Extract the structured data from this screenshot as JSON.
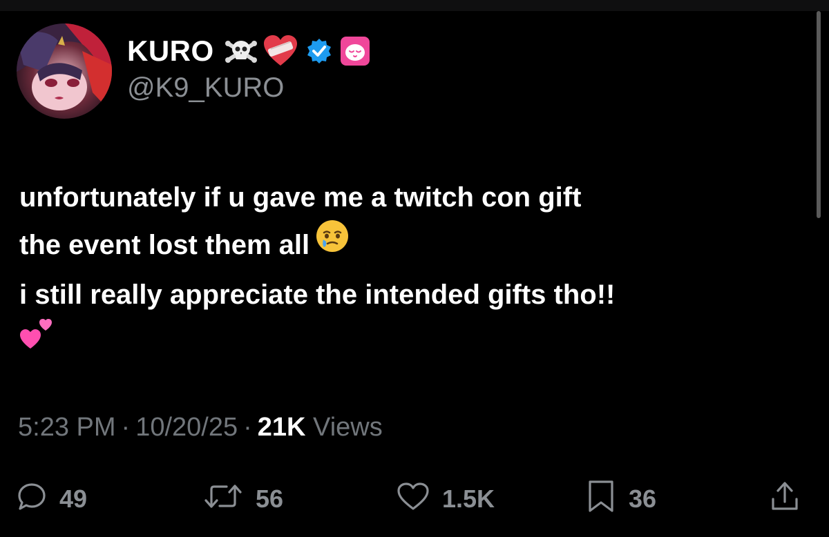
{
  "author": {
    "display_name": "KURO",
    "handle": "@K9_KURO",
    "name_emojis": [
      "skull-crossbones",
      "mending-heart"
    ],
    "verified": true,
    "affiliate_badge": "pink-sleepy-face"
  },
  "tweet": {
    "lines": [
      "unfortunately if u gave me a twitch con gift",
      "the event lost them all",
      "i still really appreciate the intended gifts tho!!"
    ],
    "emojis": [
      "face-holding-back-tears",
      "two-hearts"
    ]
  },
  "meta": {
    "time": "5:23 PM",
    "date": "10/20/25",
    "views_count": "21K",
    "views_label": "Views",
    "separator": "·"
  },
  "actions": {
    "replies": "49",
    "reposts": "56",
    "likes": "1.5K",
    "bookmarks": "36"
  },
  "colors": {
    "background": "#000000",
    "primary_text": "#ffffff",
    "secondary_text": "#71767b",
    "verified_blue": "#1d9bf0",
    "badge_pink": "#f0479a"
  }
}
